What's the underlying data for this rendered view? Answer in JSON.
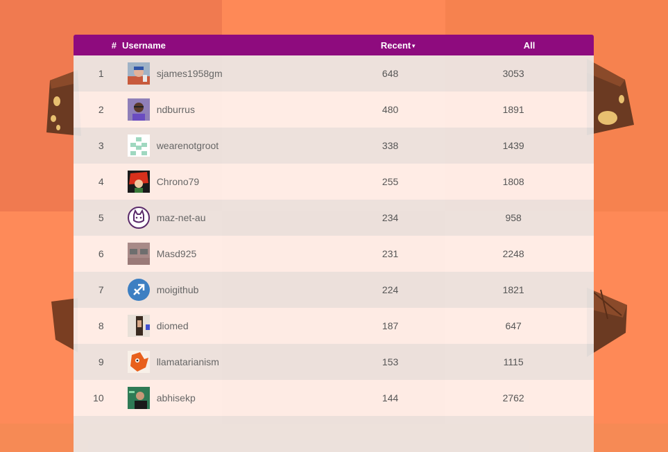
{
  "table": {
    "columns": {
      "rank": "#",
      "username": "Username",
      "recent": "Recent",
      "recent_sort_icon": "sort-desc-caret",
      "all": "All"
    },
    "rows": [
      {
        "rank": "1",
        "username": "sjames1958gm",
        "recent": "648",
        "all": "3053",
        "avatar": "avatar-photo"
      },
      {
        "rank": "2",
        "username": "ndburrus",
        "recent": "480",
        "all": "1891",
        "avatar": "avatar-photo"
      },
      {
        "rank": "3",
        "username": "wearenotgroot",
        "recent": "338",
        "all": "1439",
        "avatar": "identicon"
      },
      {
        "rank": "4",
        "username": "Chrono79",
        "recent": "255",
        "all": "1808",
        "avatar": "avatar-illustration"
      },
      {
        "rank": "5",
        "username": "maz-net-au",
        "recent": "234",
        "all": "958",
        "avatar": "avatar-cat-logo"
      },
      {
        "rank": "6",
        "username": "Masd925",
        "recent": "231",
        "all": "2248",
        "avatar": "avatar-photo"
      },
      {
        "rank": "7",
        "username": "moigithub",
        "recent": "224",
        "all": "1821",
        "avatar": "sagittarius-icon"
      },
      {
        "rank": "8",
        "username": "diomed",
        "recent": "187",
        "all": "647",
        "avatar": "avatar-photo"
      },
      {
        "rank": "9",
        "username": "llamatarianism",
        "recent": "153",
        "all": "1115",
        "avatar": "avatar-illustration"
      },
      {
        "rank": "10",
        "username": "abhisekp",
        "recent": "144",
        "all": "2762",
        "avatar": "avatar-photo"
      }
    ]
  },
  "colors": {
    "header_bg": "#8e0b7e",
    "page_bg": "#f68a55",
    "row_odd": "#ebe8e7",
    "row_even": "#fff3f0"
  }
}
